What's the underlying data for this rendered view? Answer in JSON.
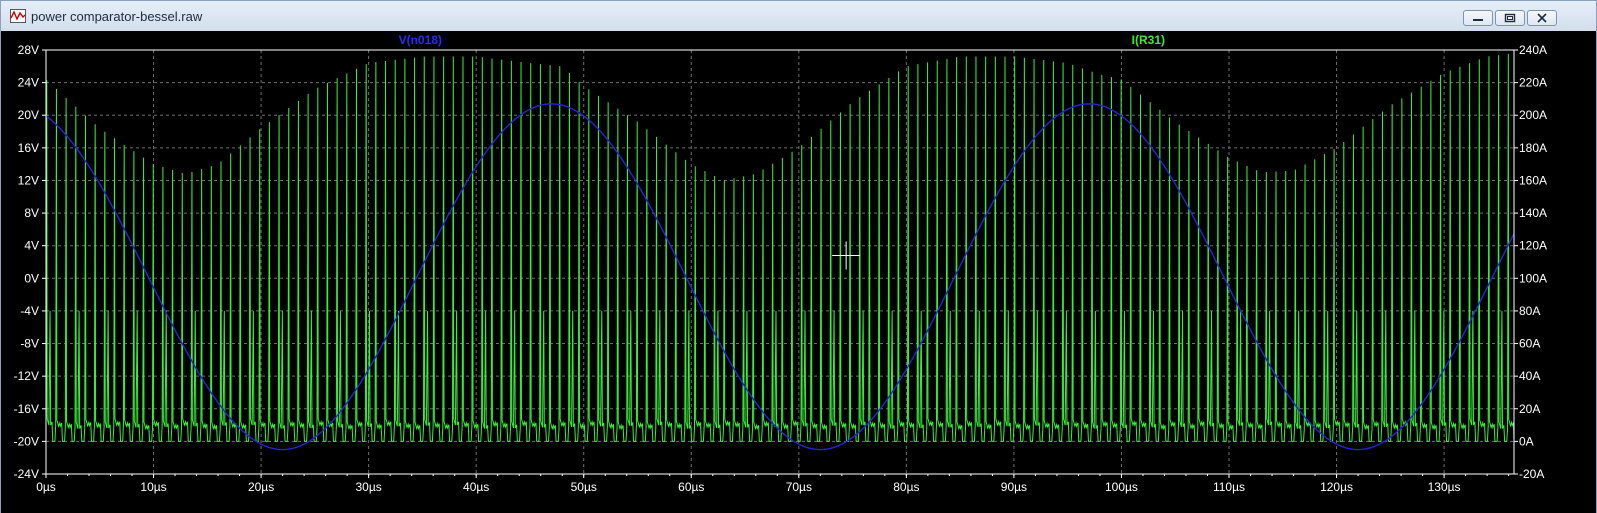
{
  "window": {
    "title": "power comparator-bessel.raw",
    "icons": [
      "waveform-app-icon",
      "minimize-icon",
      "restore-icon",
      "close-icon"
    ]
  },
  "colors": {
    "background": "#000000",
    "grid": "#6e6e6e",
    "axis_text": "#ffffff",
    "trace1": "#2424d8",
    "trace2": "#39ee39",
    "trace1_label": "#2a2aff",
    "trace2_label": "#39ee39"
  },
  "chart_data": {
    "type": "line",
    "x": {
      "unit": "µs",
      "range": [
        0,
        136.5
      ],
      "ticks": [
        0,
        10,
        20,
        30,
        40,
        50,
        60,
        70,
        80,
        90,
        100,
        110,
        120,
        130
      ],
      "tick_labels": [
        "0µs",
        "10µs",
        "20µs",
        "30µs",
        "40µs",
        "50µs",
        "60µs",
        "70µs",
        "80µs",
        "90µs",
        "100µs",
        "110µs",
        "120µs",
        "130µs"
      ]
    },
    "y_left": {
      "unit": "V",
      "range": [
        -24,
        28
      ],
      "tick_labels": [
        "28V",
        "24V",
        "20V",
        "16V",
        "12V",
        "8V",
        "4V",
        "0V",
        "-4V",
        "-8V",
        "-12V",
        "-16V",
        "-20V",
        "-24V"
      ]
    },
    "y_right": {
      "unit": "A",
      "range": [
        -20,
        240
      ],
      "tick_labels": [
        "240A",
        "220A",
        "200A",
        "180A",
        "160A",
        "140A",
        "120A",
        "100A",
        "80A",
        "60A",
        "40A",
        "20A",
        "0A",
        "-20A"
      ]
    },
    "grid": true,
    "cursor": {
      "x": 74.4,
      "y_left": 2.8
    },
    "series": [
      {
        "name": "V(n018)",
        "axis": "left",
        "shape": "sinusoid",
        "period_us": 50,
        "offset_v": 0.2,
        "amplitude_v": 21.2,
        "peak_at_us": 47,
        "points": [
          [
            0,
            19.8
          ],
          [
            5,
            12.9
          ],
          [
            10,
            3.1
          ],
          [
            15,
            -9.5
          ],
          [
            20,
            -18.9
          ],
          [
            22,
            -21
          ],
          [
            25,
            -20.5
          ],
          [
            30,
            -14.9
          ],
          [
            35,
            -4.7
          ],
          [
            40,
            7.5
          ],
          [
            45,
            18.8
          ],
          [
            47,
            21.4
          ],
          [
            50,
            20.6
          ],
          [
            55,
            15.3
          ],
          [
            60,
            3.3
          ],
          [
            65,
            -9
          ],
          [
            70,
            -18.5
          ],
          [
            72,
            -21
          ],
          [
            75,
            -19.7
          ],
          [
            80,
            -13.5
          ],
          [
            85,
            -2.6
          ],
          [
            90,
            9.4
          ],
          [
            95,
            19.3
          ],
          [
            97,
            21.4
          ],
          [
            100,
            20.1
          ],
          [
            105,
            12.6
          ],
          [
            110,
            1.5
          ],
          [
            115,
            -10.2
          ],
          [
            120,
            -19.2
          ],
          [
            122,
            -21
          ],
          [
            125,
            -19.6
          ],
          [
            130,
            -12.7
          ],
          [
            136.5,
            4.5
          ]
        ]
      },
      {
        "name": "I(R31)",
        "axis": "right",
        "shape": "switching-pulses",
        "pulse_period_us": 0.9,
        "baseline_a": 10,
        "floor_a": 0,
        "secondary_peak_a": 100,
        "envelope_peak_a": [
          [
            0,
            222
          ],
          [
            5,
            192
          ],
          [
            10,
            170
          ],
          [
            13,
            164
          ],
          [
            16,
            170
          ],
          [
            20,
            192
          ],
          [
            25,
            216
          ],
          [
            30,
            232
          ],
          [
            35,
            236
          ],
          [
            40,
            236
          ],
          [
            45,
            232
          ],
          [
            48,
            230
          ],
          [
            50,
            218
          ],
          [
            55,
            196
          ],
          [
            60,
            170
          ],
          [
            63,
            160
          ],
          [
            66,
            164
          ],
          [
            70,
            180
          ],
          [
            75,
            208
          ],
          [
            80,
            230
          ],
          [
            85,
            236
          ],
          [
            90,
            236
          ],
          [
            95,
            232
          ],
          [
            98,
            225
          ],
          [
            100,
            222
          ],
          [
            105,
            196
          ],
          [
            110,
            174
          ],
          [
            113,
            165
          ],
          [
            116,
            166
          ],
          [
            120,
            180
          ],
          [
            125,
            206
          ],
          [
            130,
            226
          ],
          [
            134,
            236
          ],
          [
            136.5,
            238
          ]
        ]
      }
    ]
  }
}
